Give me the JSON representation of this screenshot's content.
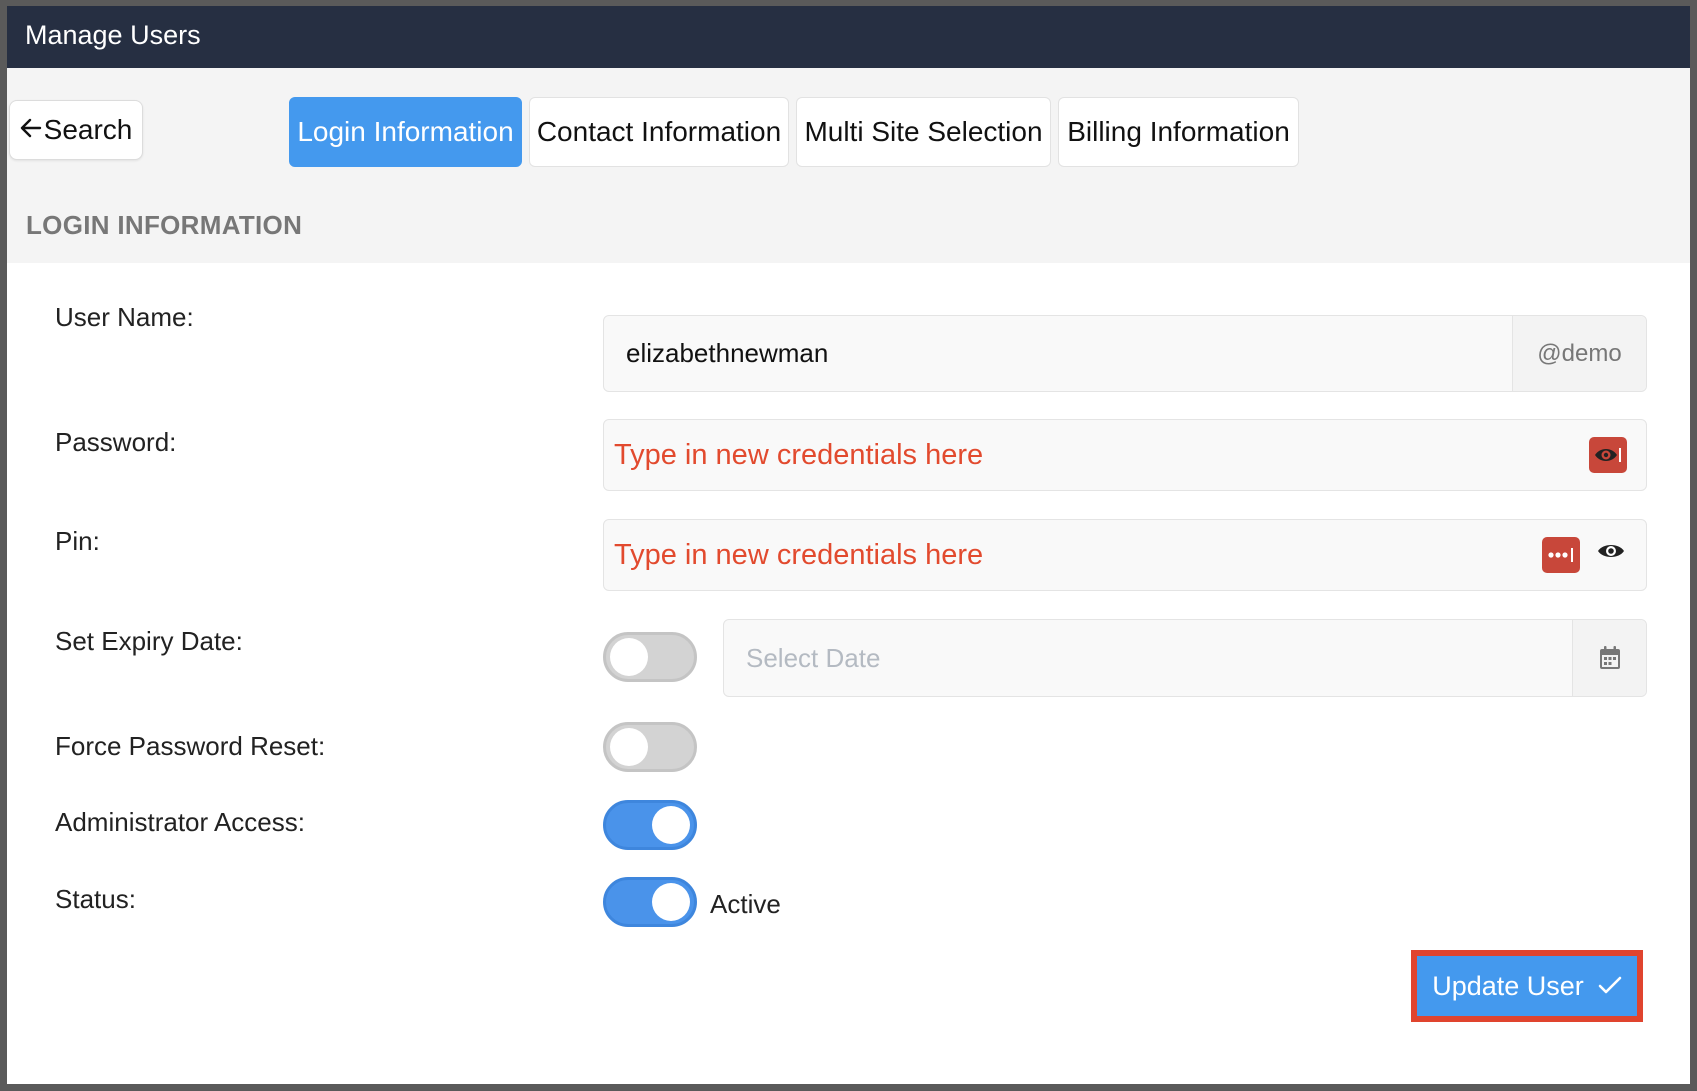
{
  "window": {
    "title": "Manage Users"
  },
  "toolbar": {
    "search_label": "Search",
    "tabs": [
      {
        "label": "Login Information",
        "active": true
      },
      {
        "label": "Contact Information",
        "active": false
      },
      {
        "label": "Multi Site Selection",
        "active": false
      },
      {
        "label": "Billing Information",
        "active": false
      }
    ],
    "section_title": "LOGIN INFORMATION"
  },
  "form": {
    "username": {
      "label": "User Name:",
      "value": "elizabethnewman",
      "suffix": "@demo"
    },
    "password": {
      "label": "Password:",
      "placeholder": "Type in new credentials here"
    },
    "pin": {
      "label": "Pin:",
      "placeholder": "Type in new credentials here"
    },
    "expiry": {
      "label": "Set Expiry Date:",
      "enabled": false,
      "placeholder": "Select Date"
    },
    "force_reset": {
      "label": "Force Password Reset:",
      "enabled": false
    },
    "admin": {
      "label": "Administrator Access:",
      "enabled": true
    },
    "status": {
      "label": "Status:",
      "enabled": true,
      "value_text": "Active"
    }
  },
  "actions": {
    "update_label": "Update User"
  },
  "colors": {
    "titlebar": "#262f42",
    "accent": "#4499ee",
    "error": "#e24a2e",
    "highlight": "#e0442e"
  },
  "icons": {
    "back": "arrow-left-icon",
    "password_key": "eye-key-icon",
    "pin_key": "dots-key-icon",
    "reveal": "eye-icon",
    "calendar": "calendar-icon",
    "check": "check-icon"
  }
}
